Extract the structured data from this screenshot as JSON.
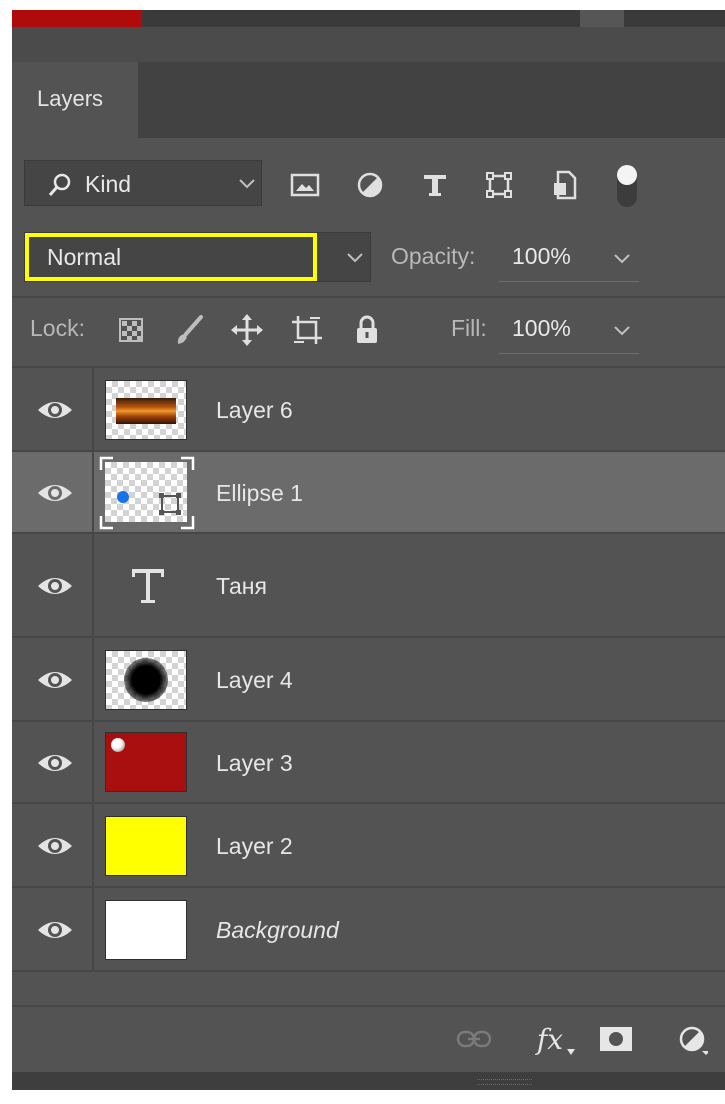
{
  "panel": {
    "tab_label": "Layers"
  },
  "filter": {
    "kind_label": "Kind",
    "icons": [
      "image-filter-icon",
      "adjustment-filter-icon",
      "type-filter-icon",
      "shape-filter-icon",
      "smart-object-filter-icon",
      "filter-toggle-icon"
    ]
  },
  "blend": {
    "mode": "Normal",
    "opacity_label": "Opacity:",
    "opacity_value": "100%"
  },
  "lock": {
    "label": "Lock:",
    "icons": [
      "lock-transparent-pixels-icon",
      "lock-image-pixels-icon",
      "lock-position-icon",
      "lock-artboard-icon",
      "lock-all-icon"
    ],
    "fill_label": "Fill:",
    "fill_value": "100%"
  },
  "layers": [
    {
      "name": "Layer 6",
      "visible": true,
      "selected": false,
      "thumb": "sunset-image"
    },
    {
      "name": "Ellipse 1",
      "visible": true,
      "selected": true,
      "thumb": "shape"
    },
    {
      "name": "Таня",
      "visible": true,
      "selected": false,
      "thumb": "type"
    },
    {
      "name": "Layer 4",
      "visible": true,
      "selected": false,
      "thumb": "blurred-dot"
    },
    {
      "name": "Layer 3",
      "visible": true,
      "selected": false,
      "thumb": "red-fill",
      "color": "#aa0f10"
    },
    {
      "name": "Layer 2",
      "visible": true,
      "selected": false,
      "thumb": "yellow-fill",
      "color": "#ffff00"
    },
    {
      "name": "Background",
      "visible": true,
      "selected": false,
      "thumb": "white-fill",
      "color": "#ffffff",
      "italic": true
    }
  ],
  "footer": {
    "icons": [
      "link-layers-icon",
      "fx-icon",
      "add-mask-icon",
      "new-adjustment-icon"
    ],
    "fx_label": "fx"
  },
  "colors": {
    "panel": "#535353",
    "selected_row": "#6b6b6b",
    "highlight": "#ffff00",
    "accent_red": "#b00b0b"
  }
}
